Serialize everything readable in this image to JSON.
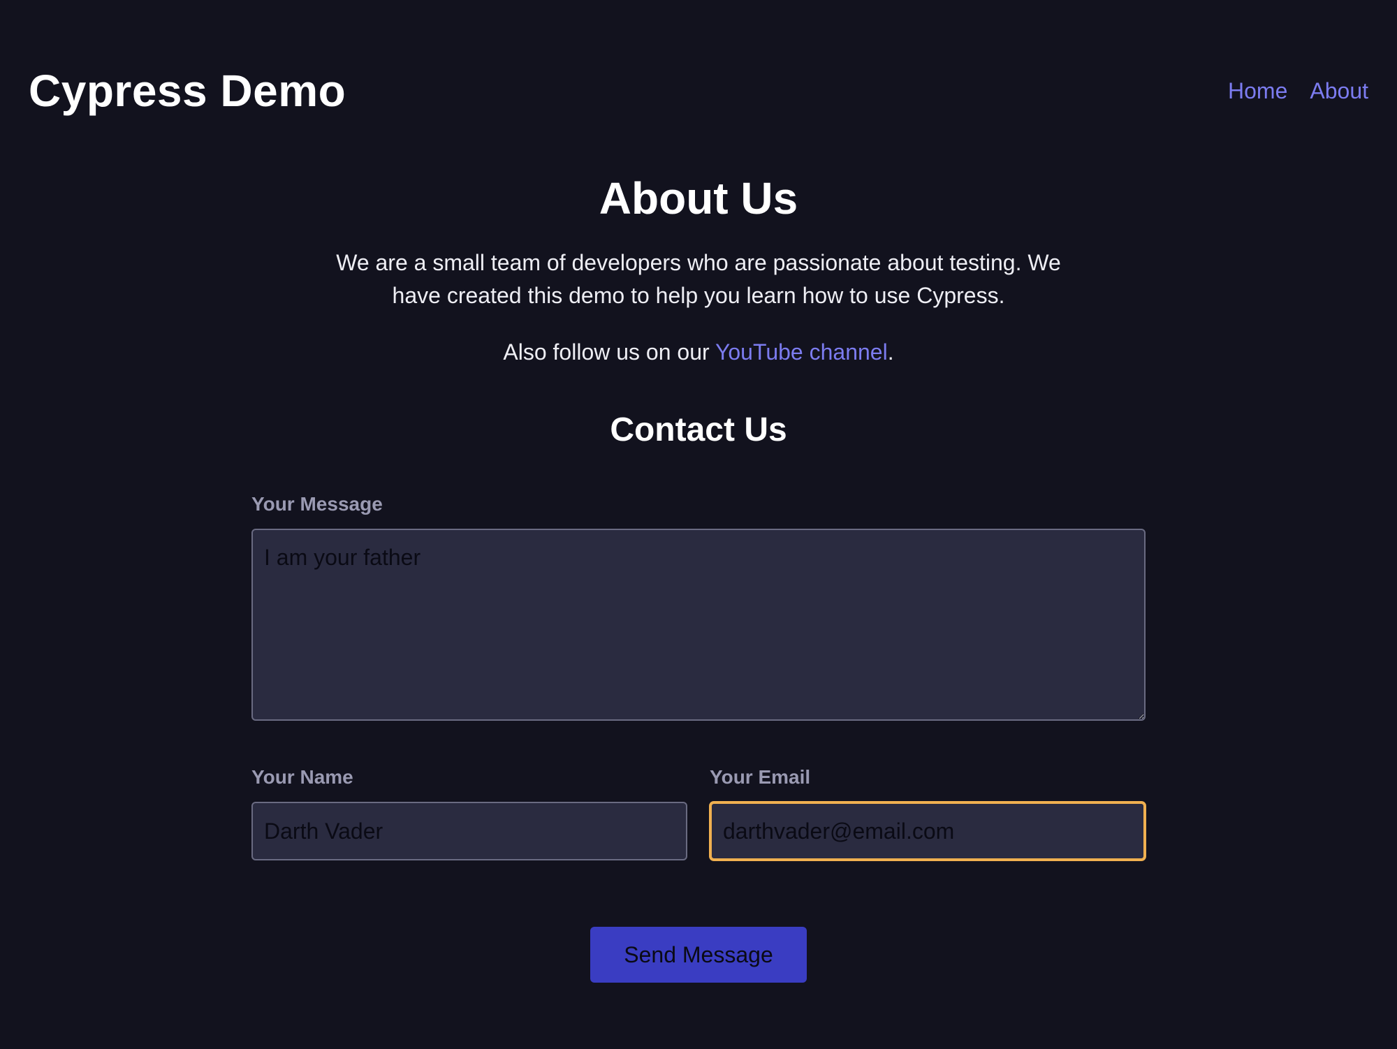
{
  "header": {
    "site_title": "Cypress Demo",
    "nav": [
      {
        "label": "Home"
      },
      {
        "label": "About"
      }
    ]
  },
  "about": {
    "title": "About Us",
    "description": "We are a small team of developers who are passionate about testing. We have created this demo to help you learn how to use Cypress.",
    "follow_prefix": "Also follow us on our ",
    "follow_link": "YouTube channel",
    "follow_suffix": "."
  },
  "contact": {
    "title": "Contact Us",
    "message_label": "Your Message",
    "message_value": "I am your father",
    "name_label": "Your Name",
    "name_value": "Darth Vader",
    "email_label": "Your Email",
    "email_value": "darthvader@email.com",
    "submit_label": "Send Message"
  },
  "colors": {
    "background": "#12121e",
    "link": "#7c7cf0",
    "input_background": "#2a2b40",
    "focus_ring": "#f0b050",
    "button": "#3a3dc2"
  }
}
